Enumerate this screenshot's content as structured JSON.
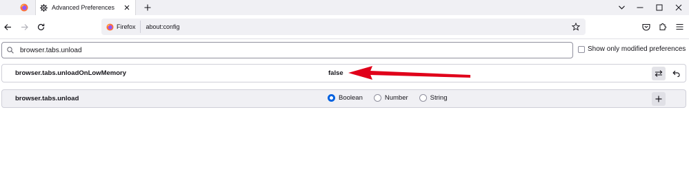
{
  "tabs": {
    "active_title": "Advanced Preferences"
  },
  "navbar": {
    "identity_label": "Firefox",
    "url": "about:config"
  },
  "search": {
    "value": "browser.tabs.unload"
  },
  "filter": {
    "modified_label": "Show only modified preferences"
  },
  "prefs": [
    {
      "name": "browser.tabs.unloadOnLowMemory",
      "value": "false"
    }
  ],
  "new_pref": {
    "name": "browser.tabs.unload",
    "types": [
      "Boolean",
      "Number",
      "String"
    ],
    "selected": "Boolean"
  },
  "colors": {
    "accent": "#0061e0",
    "annotation_arrow": "#e0001a"
  }
}
